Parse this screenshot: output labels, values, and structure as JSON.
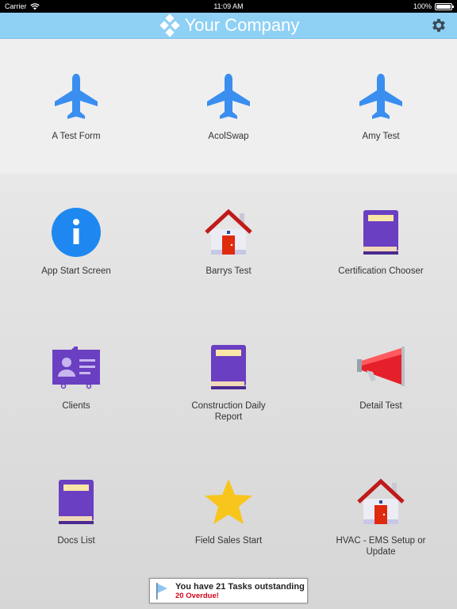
{
  "status_bar": {
    "carrier": "Carrier",
    "time": "11:09 AM",
    "battery": "100%",
    "battery_level": 1.0
  },
  "nav_bar": {
    "title": "Your Company",
    "settings_icon": "gear-icon",
    "brand_color": "#8fd0f5"
  },
  "tiles": [
    {
      "label": "A Test Form",
      "icon": "airplane-icon"
    },
    {
      "label": "AcolSwap",
      "icon": "airplane-icon"
    },
    {
      "label": "Amy Test",
      "icon": "airplane-icon"
    },
    {
      "label": "App Start Screen",
      "icon": "info-icon"
    },
    {
      "label": "Barrys Test",
      "icon": "house-icon"
    },
    {
      "label": "Certification Chooser",
      "icon": "book-icon"
    },
    {
      "label": "Clients",
      "icon": "contact-card-icon"
    },
    {
      "label": "Construction Daily Report",
      "icon": "book-icon"
    },
    {
      "label": "Detail Test",
      "icon": "megaphone-icon"
    },
    {
      "label": "Docs List",
      "icon": "book-icon"
    },
    {
      "label": "Field Sales Start",
      "icon": "star-icon"
    },
    {
      "label": "HVAC - EMS Setup or Update",
      "icon": "house-icon"
    }
  ],
  "notice": {
    "message": "You have 21 Tasks outstanding",
    "overdue": "20 Overdue!",
    "icon": "flag-icon"
  }
}
